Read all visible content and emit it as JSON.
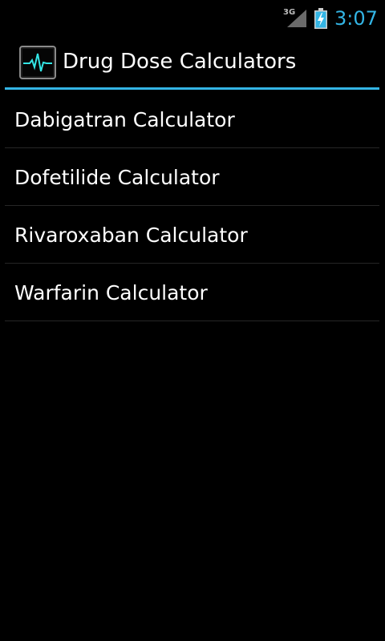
{
  "status_bar": {
    "network_type": "3G",
    "clock": "3:07",
    "signal_icon": "signal-icon",
    "battery_icon": "battery-charging-icon",
    "accent_color": "#33b5e5"
  },
  "action_bar": {
    "title": "Drug Dose Calculators",
    "app_icon": "heartbeat-monitor-icon",
    "divider_color": "#33b5e5"
  },
  "list": {
    "items": [
      {
        "label": "Dabigatran Calculator"
      },
      {
        "label": "Dofetilide Calculator"
      },
      {
        "label": "Rivaroxaban Calculator"
      },
      {
        "label": "Warfarin Calculator"
      }
    ]
  }
}
